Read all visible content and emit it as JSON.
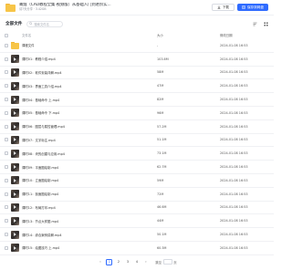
{
  "header": {
    "title": "菁蔻（CAD教程全集·视频版）从基础入门到进阶实...",
    "meta": "请7天分享 · 3.42GB",
    "download_label": "下载",
    "save_label": "保存到网盘"
  },
  "toolbar": {
    "breadcrumb": "全部文件",
    "search_placeholder": "搜索文件名"
  },
  "columns": {
    "name": "文件名",
    "size": "大小",
    "date": "修改日期"
  },
  "rows": [
    {
      "name": "课程文件",
      "size": "-",
      "date": "2024-01-08 16:53",
      "type": "folder"
    },
    {
      "name": "课时01：教程介绍.mp4",
      "size": "103.6M",
      "date": "2024-01-08 16:53",
      "type": "video"
    },
    {
      "name": "课时02：软件安装详解.mp4",
      "size": "58M",
      "date": "2024-01-08 16:53",
      "type": "video"
    },
    {
      "name": "课时03：界面工具介绍.mp4",
      "size": "47M",
      "date": "2024-01-08 16:53",
      "type": "video"
    },
    {
      "name": "课时04：基础命令 上.mp4",
      "size": "82M",
      "date": "2024-01-08 16:53",
      "type": "video"
    },
    {
      "name": "课时05：基础命令 下.mp4",
      "size": "96M",
      "date": "2024-01-08 16:53",
      "type": "video"
    },
    {
      "name": "课时06：图层与属性管理.mp4",
      "size": "57.2M",
      "date": "2024-01-08 16:53",
      "type": "video"
    },
    {
      "name": "课时07：文字标注.mp4",
      "size": "51.1M",
      "date": "2024-01-08 16:53",
      "type": "video"
    },
    {
      "name": "课时08：块的创建与应用.mp4",
      "size": "73.1M",
      "date": "2024-01-08 16:53",
      "type": "video"
    },
    {
      "name": "课时09：平面图绘制.mp4",
      "size": "62.7M",
      "date": "2024-01-08 16:53",
      "type": "video"
    },
    {
      "name": "课时10：立面图绘制.mp4",
      "size": "59M",
      "date": "2024-01-08 16:53",
      "type": "video"
    },
    {
      "name": "课时11：剖面图绘制.mp4",
      "size": "72M",
      "date": "2024-01-08 16:53",
      "type": "video"
    },
    {
      "name": "课时12：布局打印.mp4",
      "size": "46.6M",
      "date": "2024-01-08 16:53",
      "type": "video"
    },
    {
      "name": "课时13：节点大样图.mp4",
      "size": "44M",
      "date": "2024-01-08 16:53",
      "type": "video"
    },
    {
      "name": "课时14：综合案例讲解.mp4",
      "size": "50.1M",
      "date": "2024-01-08 16:53",
      "type": "video"
    },
    {
      "name": "课时15：绘图技巧 上.mp4",
      "size": "60.3M",
      "date": "2024-01-08 16:53",
      "type": "video"
    }
  ],
  "pager": {
    "prev": "‹",
    "pages": [
      "1",
      "2",
      "3",
      "4"
    ],
    "active_page": "1",
    "next": "›",
    "goto_label": "跳至",
    "goto_suffix": "页"
  },
  "colors": {
    "accent": "#2f6bff",
    "folder": "#f7c548"
  }
}
